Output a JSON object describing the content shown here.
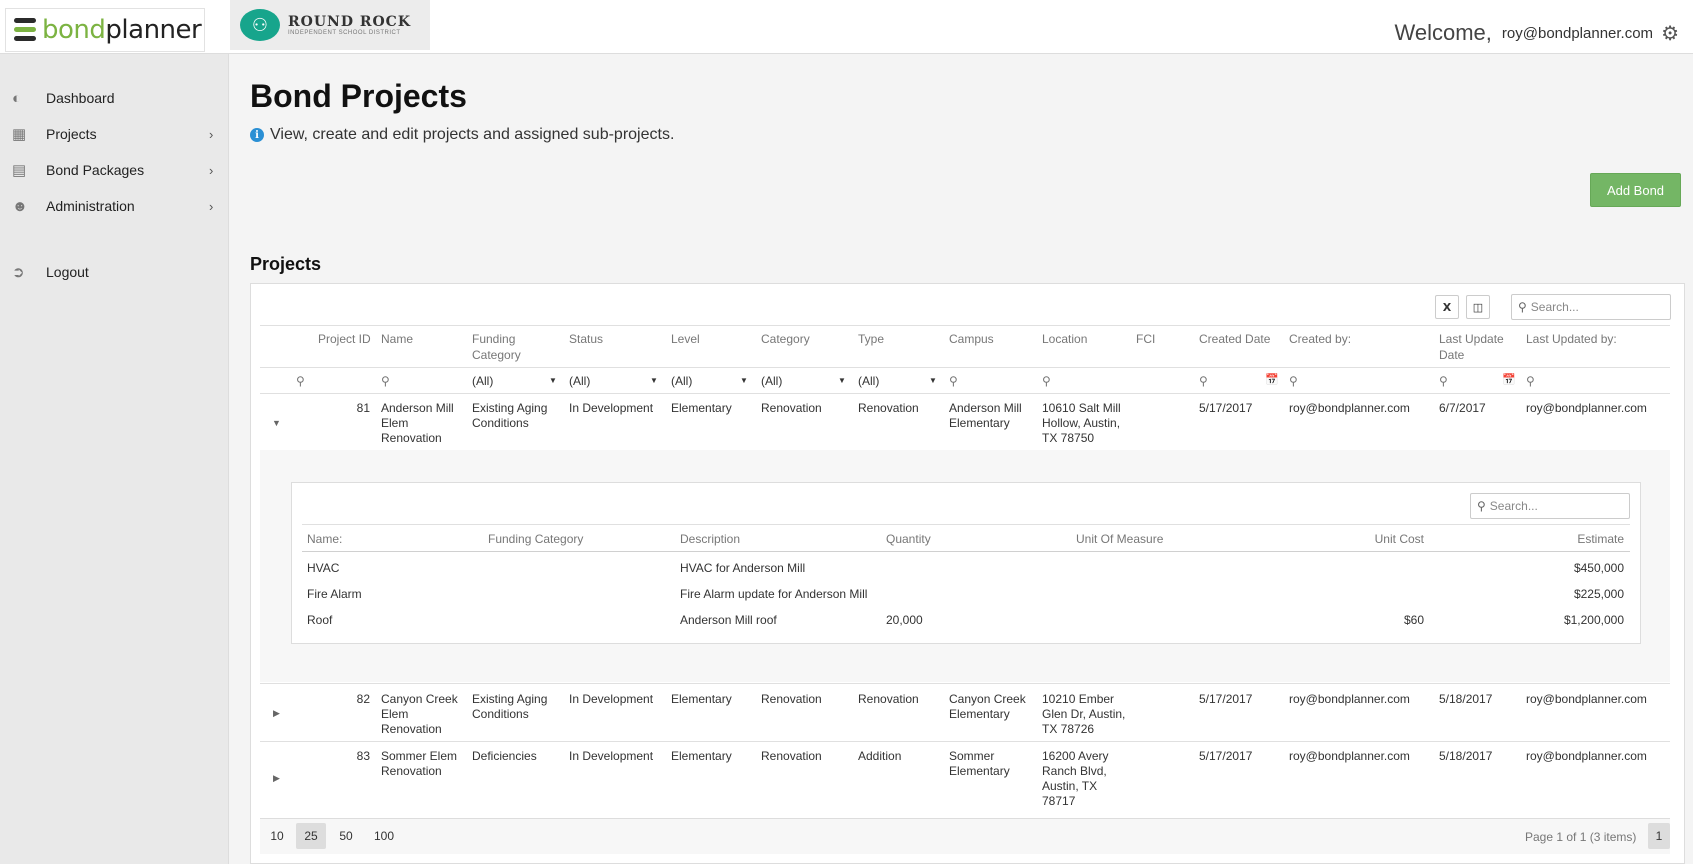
{
  "header": {
    "logo_part1": "bond",
    "logo_part2": "planner",
    "district_name": "ROUND ROCK",
    "district_sub": "INDEPENDENT SCHOOL DISTRICT",
    "welcome_label": "Welcome,",
    "user_email": "roy@bondplanner.com"
  },
  "sidebar": {
    "items": [
      {
        "label": "Dashboard",
        "icon": "dashboard-icon"
      },
      {
        "label": "Projects",
        "icon": "grid-icon"
      },
      {
        "label": "Bond Packages",
        "icon": "briefcase-icon"
      },
      {
        "label": "Administration",
        "icon": "users-icon"
      },
      {
        "label": "Logout",
        "icon": "logout-icon"
      }
    ]
  },
  "main": {
    "title": "Bond Projects",
    "subtitle": "View, create and edit projects and assigned sub-projects.",
    "add_button": "Add Bond",
    "section_title": "Projects",
    "search_placeholder": "Search..."
  },
  "table": {
    "columns": [
      "Project ID",
      "Name",
      "Funding Category",
      "Status",
      "Level",
      "Category",
      "Type",
      "Campus",
      "Location",
      "FCI",
      "Created Date",
      "Created by:",
      "Last Update Date",
      "Last Updated by:"
    ],
    "column_lines": {
      "funding": [
        "Funding",
        "Category"
      ],
      "last_update": [
        "Last Update",
        "Date"
      ]
    },
    "filter_all": "(All)",
    "rows": [
      {
        "id": "81",
        "name": [
          "Anderson Mill",
          "Elem",
          "Renovation"
        ],
        "funding": [
          "Existing Aging",
          "Conditions"
        ],
        "status": "In Development",
        "level": "Elementary",
        "category": "Renovation",
        "type": "Renovation",
        "campus": [
          "Anderson Mill",
          "Elementary"
        ],
        "location": [
          "10610 Salt Mill",
          "Hollow, Austin,",
          "TX 78750"
        ],
        "fci": "",
        "created_date": "5/17/2017",
        "created_by": "roy@bondplanner.com",
        "updated_date": "6/7/2017",
        "updated_by": "roy@bondplanner.com",
        "expanded": true
      },
      {
        "id": "82",
        "name": [
          "Canyon Creek",
          "Elem",
          "Renovation"
        ],
        "funding": [
          "Existing Aging",
          "Conditions"
        ],
        "status": "In Development",
        "level": "Elementary",
        "category": "Renovation",
        "type": "Renovation",
        "campus": [
          "Canyon Creek",
          "Elementary"
        ],
        "location": [
          "10210 Ember",
          "Glen Dr, Austin,",
          "TX 78726"
        ],
        "fci": "",
        "created_date": "5/17/2017",
        "created_by": "roy@bondplanner.com",
        "updated_date": "5/18/2017",
        "updated_by": "roy@bondplanner.com",
        "expanded": false
      },
      {
        "id": "83",
        "name": [
          "Sommer Elem",
          "Renovation"
        ],
        "funding": [
          "Deficiencies"
        ],
        "status": "In Development",
        "level": "Elementary",
        "category": "Renovation",
        "type": "Addition",
        "campus": [
          "Sommer",
          "Elementary"
        ],
        "location": [
          "16200 Avery",
          "Ranch Blvd,",
          "Austin, TX",
          "78717"
        ],
        "fci": "",
        "created_date": "5/17/2017",
        "created_by": "roy@bondplanner.com",
        "updated_date": "5/18/2017",
        "updated_by": "roy@bondplanner.com",
        "expanded": false
      }
    ]
  },
  "subtable": {
    "columns": [
      "Name:",
      "Funding Category",
      "Description",
      "Quantity",
      "Unit Of Measure",
      "Unit Cost",
      "Estimate"
    ],
    "rows": [
      {
        "name": "HVAC",
        "funding": "",
        "description": "HVAC for Anderson Mill",
        "quantity": "",
        "uom": "",
        "unit_cost": "",
        "estimate": "$450,000"
      },
      {
        "name": "Fire Alarm",
        "funding": "",
        "description": "Fire Alarm update for Anderson Mill",
        "quantity": "",
        "uom": "",
        "unit_cost": "",
        "estimate": "$225,000"
      },
      {
        "name": "Roof",
        "funding": "",
        "description": "Anderson Mill roof",
        "quantity": "20,000",
        "uom": "",
        "unit_cost": "$60",
        "estimate": "$1,200,000"
      }
    ]
  },
  "pager": {
    "sizes": [
      "10",
      "25",
      "50",
      "100"
    ],
    "active_size": "25",
    "info": "Page 1 of 1 (3 items)",
    "current_page": "1"
  },
  "colors": {
    "brand_green": "#7cb342",
    "button_green": "#74b665",
    "district_teal": "#17a58c",
    "info_blue": "#2a8fd4"
  }
}
